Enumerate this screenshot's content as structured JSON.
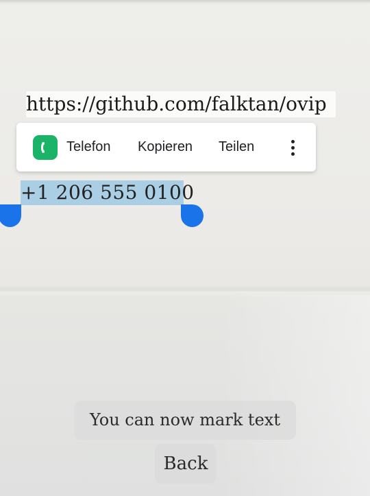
{
  "recognized_text": {
    "url": "https://github.com/falktan/ovip",
    "phone_number": "+1 206 555 0100"
  },
  "selection_toolbar": {
    "phone_label": "Telefon",
    "copy_label": "Kopieren",
    "share_label": "Teilen",
    "phone_icon": "phone-app-icon",
    "more_icon": "more-vert-icon",
    "phone_icon_color": "#1ab367"
  },
  "selection": {
    "highlight_color": "#87bee1",
    "handle_color": "#1a73e8"
  },
  "toast": {
    "message": "You can now mark text"
  },
  "controls": {
    "back_label": "Back"
  }
}
